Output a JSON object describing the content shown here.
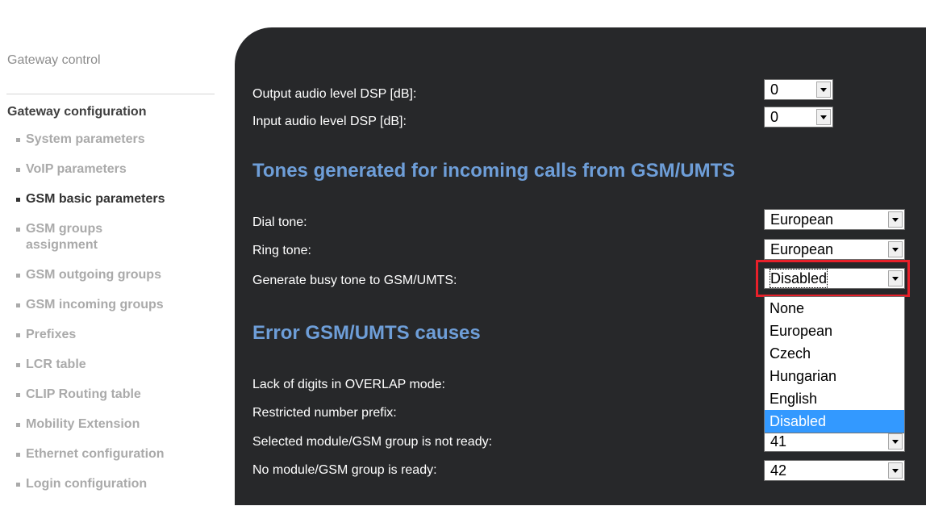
{
  "sidebar": {
    "gateway_control": "Gateway control",
    "gateway_configuration": "Gateway configuration",
    "items": [
      {
        "label": "System parameters"
      },
      {
        "label": "VoIP parameters"
      },
      {
        "label": "GSM basic parameters"
      },
      {
        "label": "GSM groups assignment"
      },
      {
        "label": "GSM outgoing groups"
      },
      {
        "label": "GSM incoming groups"
      },
      {
        "label": "Prefixes"
      },
      {
        "label": "LCR table"
      },
      {
        "label": "CLIP Routing table"
      },
      {
        "label": "Mobility Extension"
      },
      {
        "label": "Ethernet configuration"
      },
      {
        "label": "Login configuration"
      }
    ],
    "active_item": "GSM basic parameters"
  },
  "audio": {
    "output_label": "Output audio level DSP [dB]:",
    "output_value": "0",
    "input_label": "Input audio level DSP [dB]:",
    "input_value": "0"
  },
  "tones": {
    "heading": "Tones generated for incoming calls from GSM/UMTS",
    "dial_label": "Dial tone:",
    "dial_value": "European",
    "ring_label": "Ring tone:",
    "ring_value": "European",
    "busy_label": "Generate busy tone to GSM/UMTS:",
    "busy_value": "Disabled",
    "busy_options": [
      "None",
      "European",
      "Czech",
      "Hungarian",
      "English",
      "Disabled"
    ]
  },
  "errors": {
    "heading": "Error GSM/UMTS causes",
    "lack_label": "Lack of digits in OVERLAP mode:",
    "restricted_label": "Restricted number prefix:",
    "not_ready_label": "Selected module/GSM group is not ready:",
    "not_ready_value": "41",
    "no_module_label": "No module/GSM group is ready:",
    "no_module_value": "42"
  },
  "colors": {
    "panel_bg": "#27282a",
    "heading_blue": "#6e9ed8",
    "highlight_red": "#e8202a",
    "selected_option": "#3399ff"
  }
}
